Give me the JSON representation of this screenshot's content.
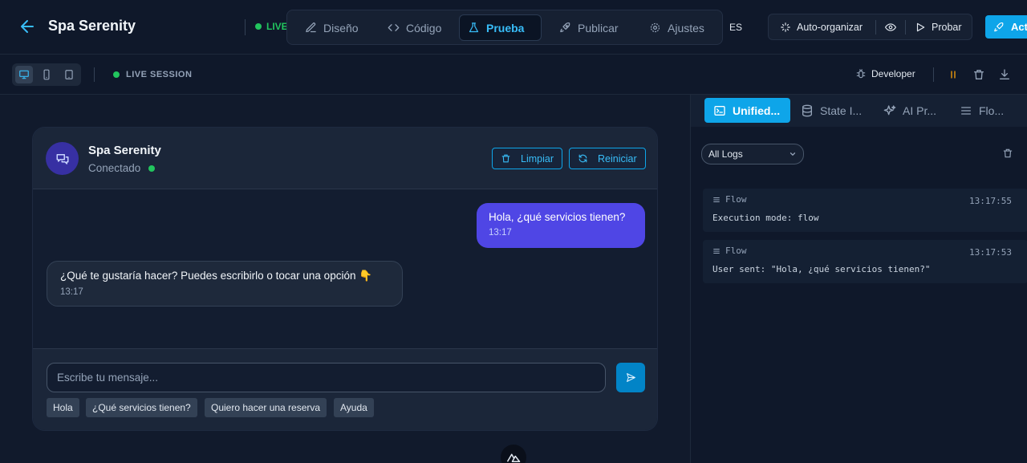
{
  "header": {
    "app_title": "Spa Serenity",
    "live_label": "LIVE",
    "tabs": [
      {
        "label": "Diseño",
        "icon": "edit-icon"
      },
      {
        "label": "Código",
        "icon": "code-icon"
      },
      {
        "label": "Prueba",
        "icon": "flask-icon",
        "active": true
      },
      {
        "label": "Publicar",
        "icon": "rocket-icon"
      },
      {
        "label": "Ajustes",
        "icon": "gear-icon"
      }
    ],
    "language": "ES",
    "auto_organize_label": "Auto-organizar",
    "test_label": "Probar",
    "activate_label": "Activar"
  },
  "toolbar": {
    "session_label": "LIVE SESSION",
    "developer_label": "Developer"
  },
  "chat": {
    "bot_name": "Spa Serenity",
    "bot_status": "Conectado",
    "clear_label": "Limpiar",
    "restart_label": "Reiniciar",
    "messages": [
      {
        "from": "user",
        "text": "Hola, ¿qué servicios tienen?",
        "time": "13:17"
      },
      {
        "from": "bot",
        "text": "¿Qué te gustaría hacer? Puedes escribirlo o tocar una opción 👇",
        "time": "13:17"
      }
    ],
    "input_placeholder": "Escribe tu mensaje...",
    "quick_replies": [
      "Hola",
      "¿Qué servicios tienen?",
      "Quiero hacer una reserva",
      "Ayuda"
    ]
  },
  "debug_panel": {
    "tabs": [
      {
        "label": "Unified...",
        "icon": "terminal-icon",
        "active": true
      },
      {
        "label": "State I...",
        "icon": "database-icon"
      },
      {
        "label": "AI Pr...",
        "icon": "sparkles-icon"
      },
      {
        "label": "Flo...",
        "icon": "list-icon"
      }
    ],
    "filter_value": "All Logs",
    "logs": [
      {
        "source": "Flow",
        "timestamp": "13:17:55",
        "message": "Execution mode: flow"
      },
      {
        "source": "Flow",
        "timestamp": "13:17:53",
        "message": "User sent: \"Hola, ¿qué servicios tienen?\""
      }
    ]
  },
  "colors": {
    "accent": "#0ea5e9",
    "user_bubble": "#4f46e5",
    "status_green": "#22c55e",
    "background": "#111a2c"
  }
}
